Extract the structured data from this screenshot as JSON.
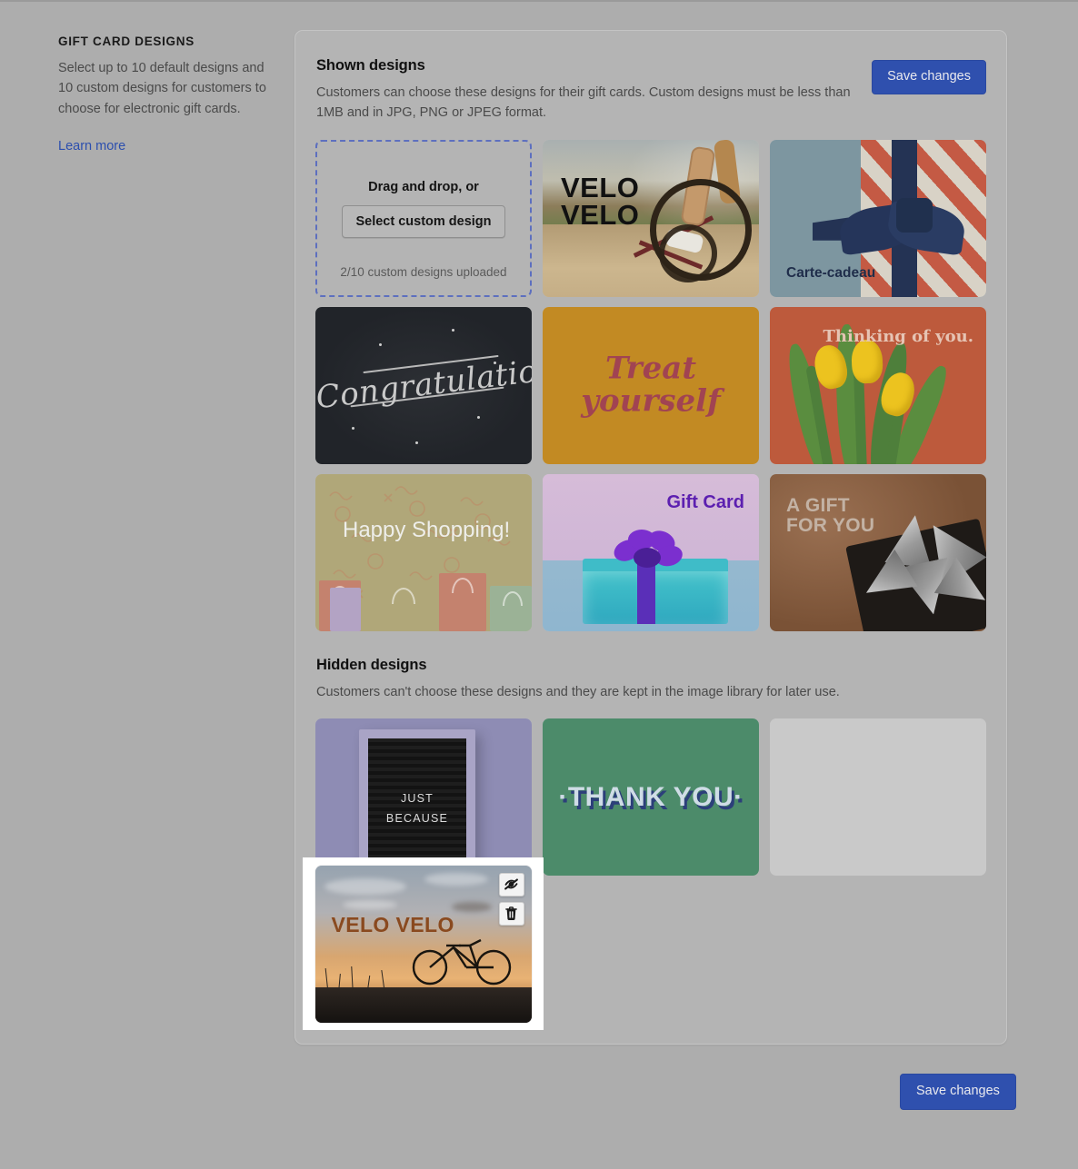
{
  "sidebar": {
    "title": "GIFT CARD DESIGNS",
    "description": "Select up to 10 default designs and 10 custom designs for customers to choose for electronic gift cards.",
    "link_label": "Learn more"
  },
  "shown_section": {
    "title": "Shown designs",
    "description": "Customers can choose these designs for their gift cards. Custom designs must be less than 1MB and in JPG, PNG or JPEG format.",
    "save_label": "Save changes",
    "dropzone": {
      "prompt": "Drag and drop, or",
      "button_label": "Select custom design",
      "count_text": "2/10 custom designs uploaded"
    },
    "designs": [
      {
        "name": "velo-velo-road",
        "caption": "VELO\nVELO",
        "line1": "VELO",
        "line2": "VELO"
      },
      {
        "name": "carte-cadeau",
        "caption": "Carte-cadeau"
      },
      {
        "name": "congratulations",
        "caption": "Congratulations"
      },
      {
        "name": "treat-yourself",
        "caption": "Treat\nyourself",
        "line1": "Treat",
        "line2": "yourself"
      },
      {
        "name": "thinking-of-you",
        "caption": "Thinking of you."
      },
      {
        "name": "happy-shopping",
        "caption": "Happy Shopping!"
      },
      {
        "name": "gift-card-purple-bow",
        "caption": "Gift Card"
      },
      {
        "name": "a-gift-for-you",
        "caption": "A GIFT\nFOR YOU",
        "line1": "A GIFT",
        "line2": "FOR YOU"
      }
    ]
  },
  "hidden_section": {
    "title": "Hidden designs",
    "description": "Customers can't choose these designs and they are kept in the image library for later use.",
    "designs": [
      {
        "name": "just-because",
        "caption": "JUST\nBECAUSE",
        "line1": "JUST",
        "line2": "BECAUSE"
      },
      {
        "name": "thank-you",
        "caption": "·THANK YOU·"
      },
      {
        "name": "wrapped-presents",
        "caption": ""
      },
      {
        "name": "velo-velo-sunset",
        "caption": "VELO VELO",
        "actions": {
          "show_icon": "eye-off-icon",
          "delete_icon": "trash-icon"
        }
      }
    ]
  },
  "footer": {
    "save_label": "Save changes"
  },
  "colors": {
    "accent": "#2f50ae",
    "link": "#2c4fae",
    "page_bg": "#adadad",
    "card_bg": "#b4b4b4",
    "dropzone_border": "#5d6fbf"
  }
}
